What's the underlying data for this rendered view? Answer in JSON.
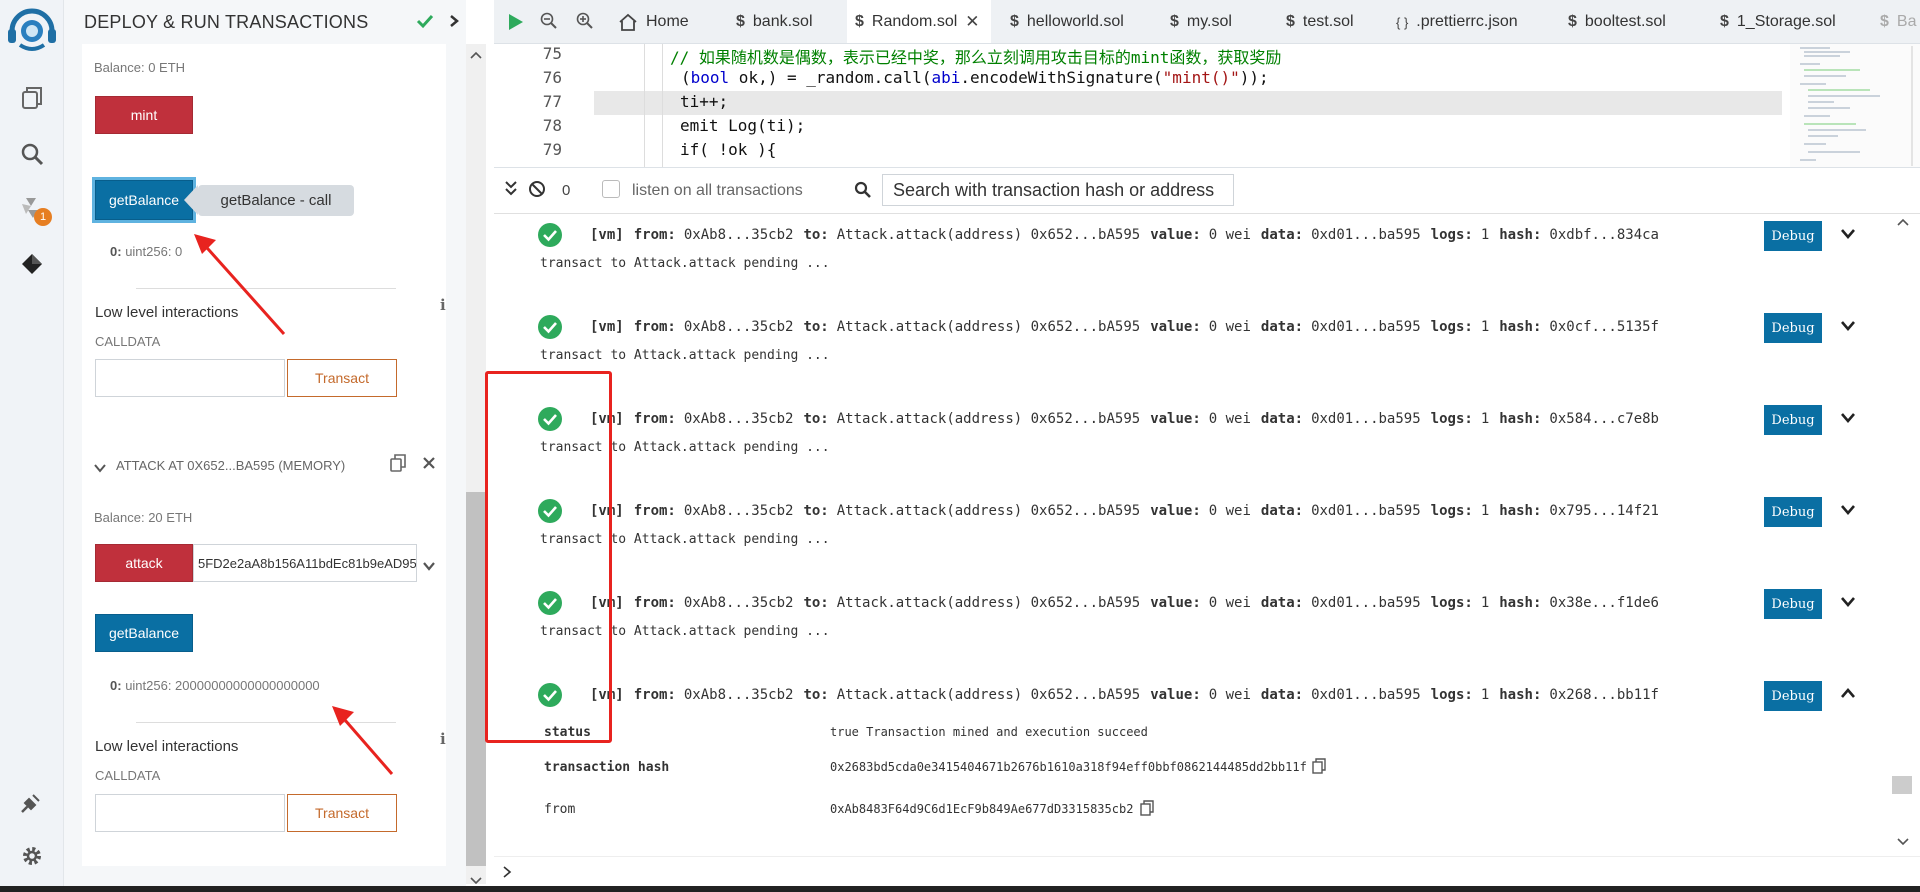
{
  "panel": {
    "title": "DEPLOY & RUN TRANSACTIONS",
    "balance_top": "Balance: 0 ETH",
    "mint_label": "mint",
    "getbalance_label": "getBalance",
    "getbalance_call_label": "getBalance - call",
    "output1_index": "0:",
    "output1_value": "uint256: 0",
    "lli_title": "Low level interactions",
    "calldata_label": "CALLDATA",
    "transact_label": "Transact",
    "instance_title": "ATTACK AT 0X652...BA595 (MEMORY)",
    "balance2": "Balance: 20 ETH",
    "attack_label": "attack",
    "attack_input": "5FD2e2aA8b156A11bdEc81b9eAD95",
    "getbalance2_label": "getBalance",
    "output2_index": "0:",
    "output2_value": "uint256: 20000000000000000000",
    "lli_title2": "Low level interactions",
    "calldata_label2": "CALLDATA",
    "transact_label2": "Transact",
    "plugin_badge": "1"
  },
  "tabs": [
    {
      "label": "Home",
      "icon": "home-icon"
    },
    {
      "label": "bank.sol",
      "icon": "solidity-icon"
    },
    {
      "label": "Random.sol",
      "icon": "solidity-icon",
      "active": true
    },
    {
      "label": "helloworld.sol",
      "icon": "solidity-icon"
    },
    {
      "label": "my.sol",
      "icon": "solidity-icon"
    },
    {
      "label": "test.sol",
      "icon": "solidity-icon"
    },
    {
      "label": ".prettierrc.json",
      "icon": "json-icon"
    },
    {
      "label": "booltest.sol",
      "icon": "solidity-icon"
    },
    {
      "label": "1_Storage.sol",
      "icon": "solidity-icon"
    },
    {
      "label": "Ba",
      "icon": "solidity-icon"
    }
  ],
  "editor": {
    "lines": [
      {
        "n": "75",
        "comment": "// 如果随机数是偶数，表示已经中奖，那么立刻调用攻击目标的mint函数，获取奖励"
      },
      {
        "n": "76",
        "pre": "(",
        "kw1": "bool",
        "mid": " ok,) = _random.call(",
        "kw2": "abi",
        "mid2": ".encodeWithSignature(",
        "str": "\"mint()\"",
        "post": "));"
      },
      {
        "n": "77",
        "text": "ti++;"
      },
      {
        "n": "78",
        "text": "emit Log(ti);"
      },
      {
        "n": "79",
        "text": "if( !ok ){"
      }
    ]
  },
  "terminal": {
    "count": "0",
    "listen_label": "listen on all transactions",
    "search_placeholder": "Search with transaction hash or address",
    "tx_labels": {
      "from": "from:",
      "to": "to:",
      "value": "value:",
      "data": "data:",
      "logs": "logs:",
      "hash": "hash:"
    },
    "debug_label": "Debug",
    "transactions": [
      {
        "env": "[vm]",
        "from": "0xAb8...35cb2",
        "to": "Attack.attack(address) 0x652...bA595",
        "value": "0 wei",
        "data": "0xd01...ba595",
        "logs": "1",
        "hash": "0xdbf...834ca",
        "pending": "transact to Attack.attack pending ..."
      },
      {
        "env": "[vm]",
        "from": "0xAb8...35cb2",
        "to": "Attack.attack(address) 0x652...bA595",
        "value": "0 wei",
        "data": "0xd01...ba595",
        "logs": "1",
        "hash": "0x0cf...5135f",
        "pending": "transact to Attack.attack pending ..."
      },
      {
        "env": "[vm]",
        "from": "0xAb8...35cb2",
        "to": "Attack.attack(address) 0x652...bA595",
        "value": "0 wei",
        "data": "0xd01...ba595",
        "logs": "1",
        "hash": "0x584...c7e8b",
        "pending": "transact to Attack.attack pending ..."
      },
      {
        "env": "[vm]",
        "from": "0xAb8...35cb2",
        "to": "Attack.attack(address) 0x652...bA595",
        "value": "0 wei",
        "data": "0xd01...ba595",
        "logs": "1",
        "hash": "0x795...14f21",
        "pending": "transact to Attack.attack pending ..."
      },
      {
        "env": "[vm]",
        "from": "0xAb8...35cb2",
        "to": "Attack.attack(address) 0x652...bA595",
        "value": "0 wei",
        "data": "0xd01...ba595",
        "logs": "1",
        "hash": "0x38e...f1de6",
        "pending": "transact to Attack.attack pending ..."
      },
      {
        "env": "[vm]",
        "from": "0xAb8...35cb2",
        "to": "Attack.attack(address) 0x652...bA595",
        "value": "0 wei",
        "data": "0xd01...ba595",
        "logs": "1",
        "hash": "0x268...bb11f"
      }
    ],
    "details": {
      "status_key": "status",
      "status_val": "true Transaction mined and execution succeed",
      "hash_key": "transaction hash",
      "hash_val": "0x2683bd5cda0e3415404671b2676b1610a318f94eff0bbf0862144485dd2bb11f",
      "from_key": "from",
      "from_val": "0xAb8483F64d9C6d1EcF9b849Ae677dD3315835cb2"
    }
  },
  "colors": {
    "accent_blue": "#0a6fa3",
    "danger_red": "#c0303c",
    "success_green": "#2eaa5c",
    "annotation_red": "#e8231f",
    "transact_orange": "#c46a2c"
  }
}
